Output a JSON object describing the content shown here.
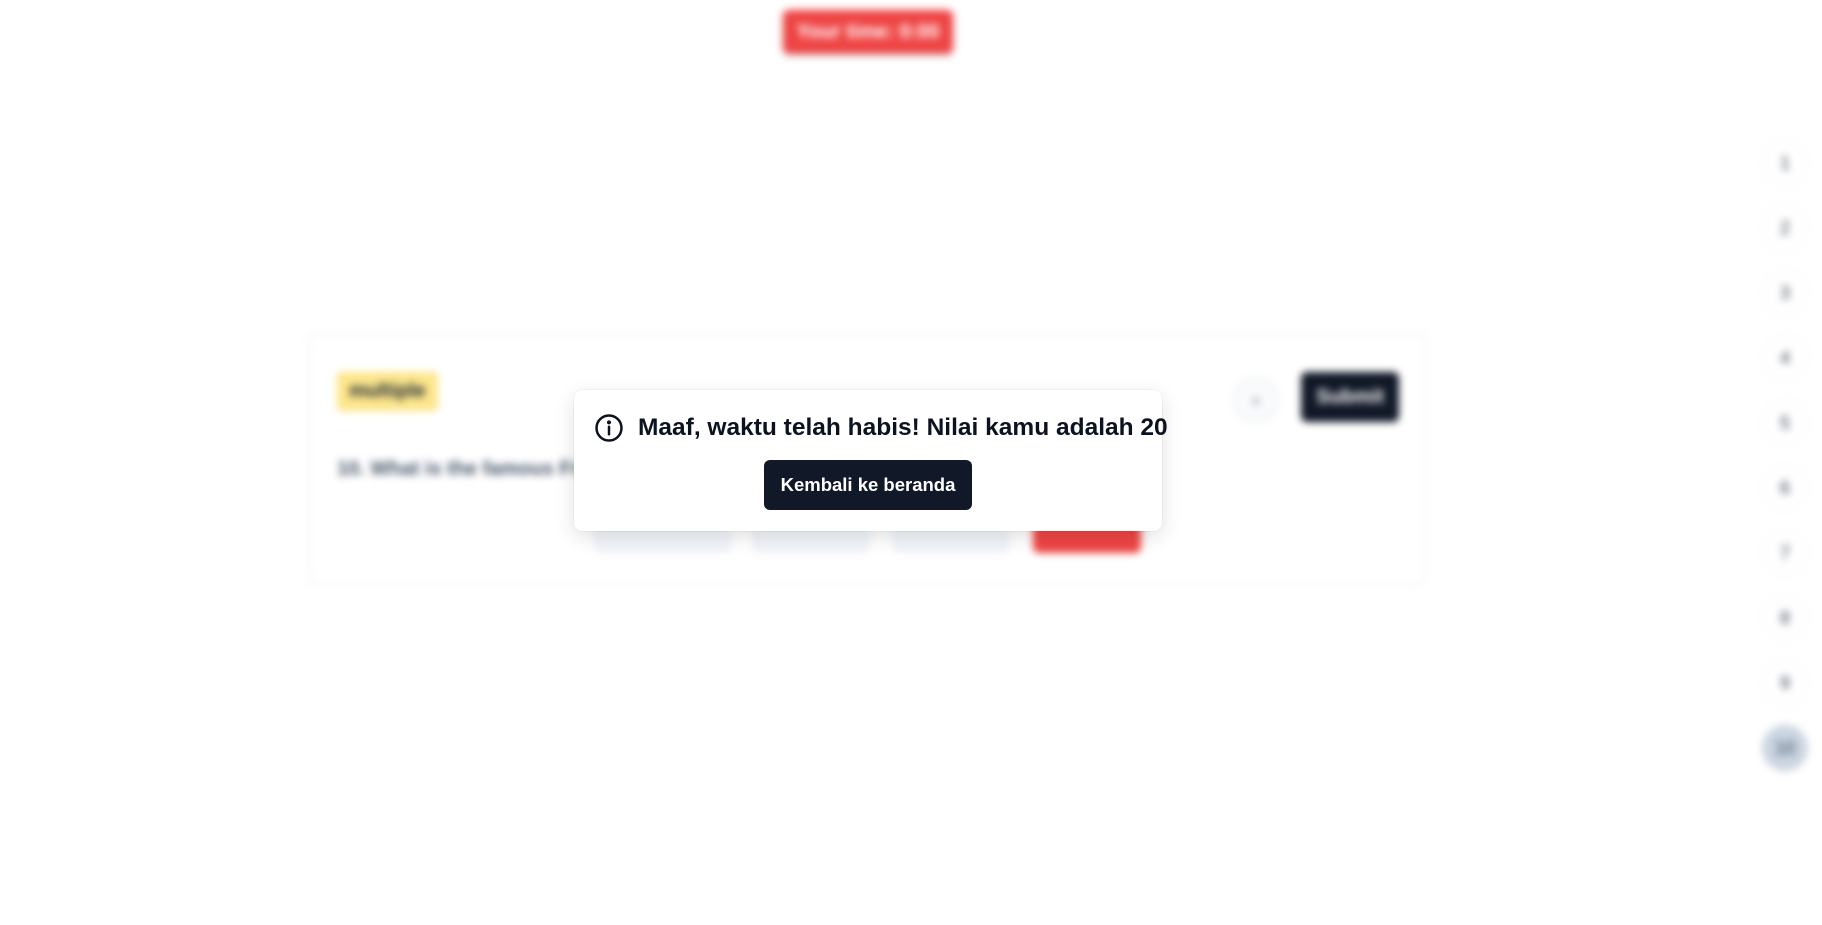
{
  "timer": {
    "label": "Your time: 0:00"
  },
  "quiz": {
    "type_badge": "multiple",
    "question": "10. What is the famous Fr",
    "submit_label": "Submit",
    "nav_icon": "chevron-icon",
    "nav_glyph": "‹"
  },
  "question_nav": {
    "items": [
      "1",
      "2",
      "3",
      "4",
      "5",
      "6",
      "7",
      "8",
      "9",
      "10"
    ],
    "active_index": 9
  },
  "modal": {
    "message": "Maaf, waktu telah habis! Nilai kamu adalah 20",
    "button_label": "Kembali ke beranda",
    "icon": "info-icon"
  },
  "colors": {
    "timer_bg": "#ef4444",
    "primary_dark": "#111827",
    "badge_bg": "#fde68a"
  }
}
